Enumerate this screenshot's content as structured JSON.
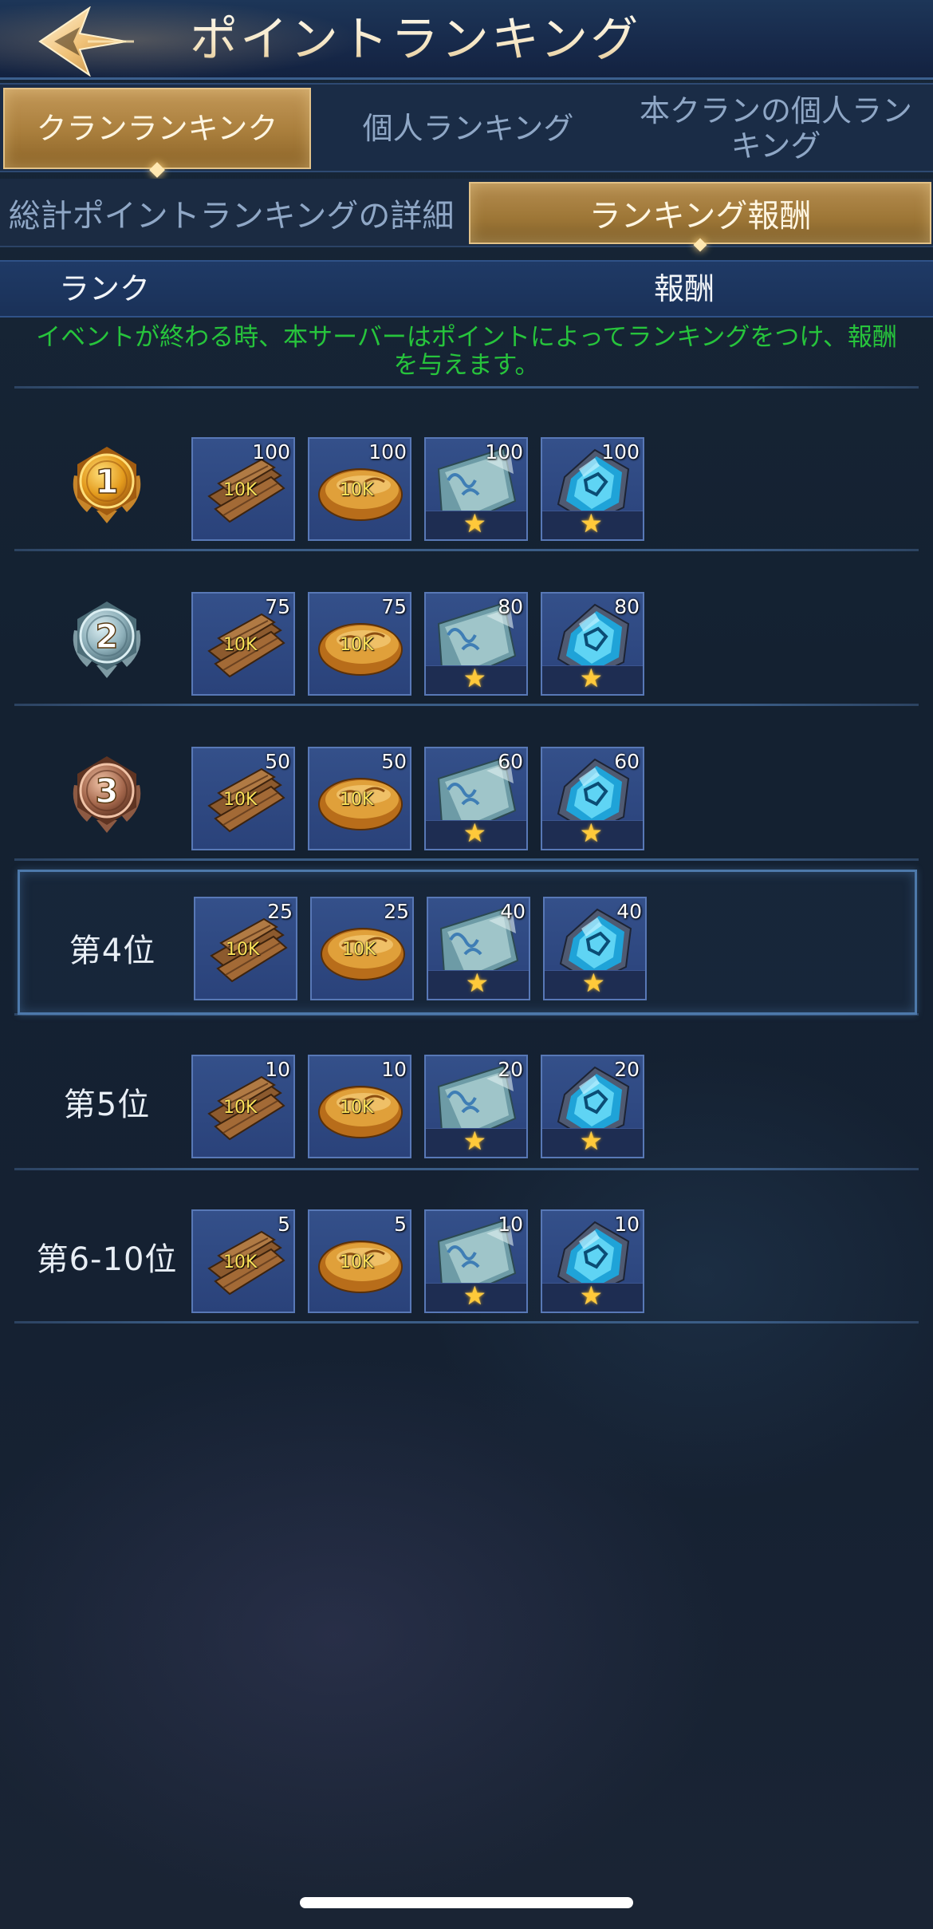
{
  "header": {
    "title": "ポイントランキング",
    "back_icon": "back-arrow-icon"
  },
  "tabs_primary": [
    {
      "label": "クランランキンク",
      "active": true
    },
    {
      "label": "個人ランキング",
      "active": false
    },
    {
      "label": "本クランの個人ランキング",
      "line1": "本クランの個人ラン",
      "line2": "キング",
      "active": false
    }
  ],
  "tabs_secondary": [
    {
      "label": "総計ポイントランキングの詳細",
      "active": false
    },
    {
      "label": "ランキング報酬",
      "active": true
    }
  ],
  "columns": {
    "rank": "ランク",
    "reward": "報酬"
  },
  "notice": {
    "line1": "イベントが終わる時、本サーバーはポイントによってランキングをつけ、報酬",
    "line2": "を与えます。"
  },
  "item_types": [
    {
      "name": "wood",
      "icon": "wood-planks-icon",
      "tag": "10K"
    },
    {
      "name": "food",
      "icon": "bread-icon",
      "tag": "10K"
    },
    {
      "name": "scroll",
      "icon": "scroll-icon",
      "star": "★"
    },
    {
      "name": "gem",
      "icon": "blue-crystal-icon",
      "star": "★"
    }
  ],
  "rows": [
    {
      "rank_label": "1",
      "medal": "gold",
      "qty": [
        "100",
        "100",
        "100",
        "100"
      ]
    },
    {
      "rank_label": "2",
      "medal": "silver",
      "qty": [
        "75",
        "75",
        "80",
        "80"
      ]
    },
    {
      "rank_label": "3",
      "medal": "bronze",
      "qty": [
        "50",
        "50",
        "60",
        "60"
      ]
    },
    {
      "rank_label": "第4位",
      "highlight": true,
      "qty": [
        "25",
        "25",
        "40",
        "40"
      ]
    },
    {
      "rank_label": "第5位",
      "qty": [
        "10",
        "10",
        "20",
        "20"
      ]
    },
    {
      "rank_label": "第6-10位",
      "qty": [
        "5",
        "5",
        "10",
        "10"
      ]
    }
  ],
  "colors": {
    "notice_green": "#27c43c",
    "gold_tab": "#b58d50",
    "item_bg": "#2e4880",
    "accent_blue": "#4d79ab"
  }
}
